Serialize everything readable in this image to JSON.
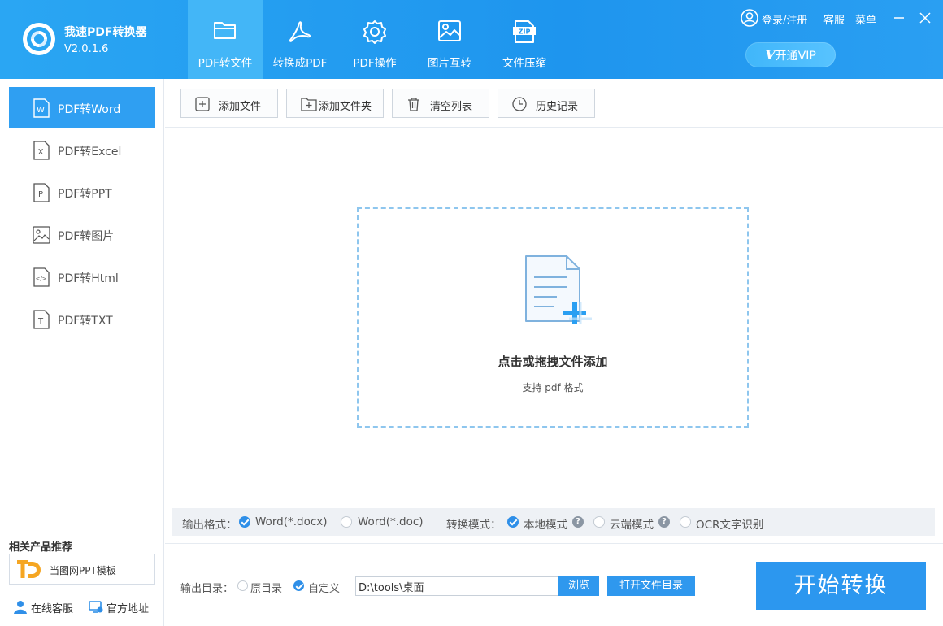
{
  "app": {
    "name": "我速PDF转换器",
    "version": "V2.0.1.6"
  },
  "nav": {
    "tabs": [
      {
        "label": "PDF转文件",
        "icon": "folder-icon",
        "active": true
      },
      {
        "label": "转换成PDF",
        "icon": "acrobat-icon",
        "active": false
      },
      {
        "label": "PDF操作",
        "icon": "gear-icon",
        "active": false
      },
      {
        "label": "图片互转",
        "icon": "image-icon",
        "active": false
      },
      {
        "label": "文件压缩",
        "icon": "zip-icon",
        "active": false
      }
    ]
  },
  "top_right": {
    "login": "登录/注册",
    "service": "客服",
    "menu": "菜单",
    "vip_prefix": "V",
    "vip_label": "开通VIP",
    "zip_text": "ZIP"
  },
  "sidebar": {
    "items": [
      {
        "label": "PDF转Word",
        "icon": "word-file-icon",
        "letter": "W",
        "active": true
      },
      {
        "label": "PDF转Excel",
        "icon": "excel-file-icon",
        "letter": "X",
        "active": false
      },
      {
        "label": "PDF转PPT",
        "icon": "ppt-file-icon",
        "letter": "P",
        "active": false
      },
      {
        "label": "PDF转图片",
        "icon": "image-file-icon",
        "letter": "",
        "active": false
      },
      {
        "label": "PDF转Html",
        "icon": "html-file-icon",
        "letter": "</>",
        "active": false
      },
      {
        "label": "PDF转TXT",
        "icon": "txt-file-icon",
        "letter": "T",
        "active": false
      }
    ],
    "related_title": "相关产品推荐",
    "related_product": "当图网PPT模板",
    "footer": {
      "online_service": "在线客服",
      "official_site": "官方地址"
    }
  },
  "toolbar": {
    "add_file": "添加文件",
    "add_folder": "添加文件夹",
    "clear_list": "清空列表",
    "history": "历史记录"
  },
  "dropzone": {
    "title": "点击或拖拽文件添加",
    "subtitle": "支持 pdf 格式"
  },
  "options": {
    "format_label": "输出格式：",
    "formats": [
      {
        "label": "Word(*.docx)",
        "checked": true
      },
      {
        "label": "Word(*.doc)",
        "checked": false
      }
    ],
    "mode_label": "转换模式：",
    "modes": [
      {
        "label": "本地模式",
        "checked": true,
        "help": true
      },
      {
        "label": "云端模式",
        "checked": false,
        "help": true
      },
      {
        "label": "OCR文字识别",
        "checked": false,
        "help": false
      }
    ]
  },
  "output": {
    "dir_label": "输出目录：",
    "original_dir": "原目录",
    "original_checked": false,
    "custom_dir": "自定义",
    "custom_checked": true,
    "path": "D:\\tools\\桌面",
    "browse": "浏览",
    "open_dir": "打开文件目录"
  },
  "start_button": "开始转换",
  "colors": {
    "brand_blue": "#2c97ef",
    "header_blue": "#2aa6f3",
    "active_tab": "#43b6f7"
  }
}
